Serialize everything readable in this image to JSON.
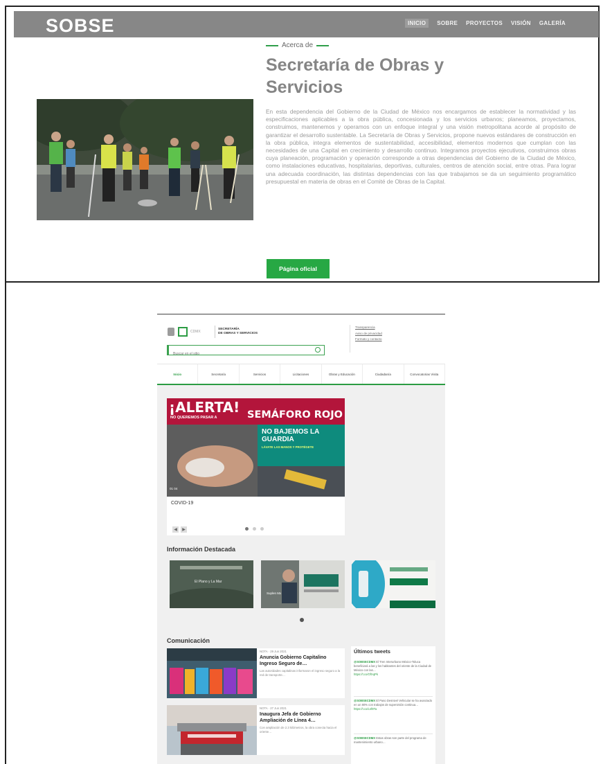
{
  "top_site": {
    "brand": "SOBSE",
    "nav": [
      "INICIO",
      "SOBRE",
      "PROYECTOS",
      "VISIÓN",
      "GALERÍA"
    ],
    "about_kicker": "Acerca de",
    "about_title": "Secretaría de Obras y Servicios",
    "about_body": "En esta dependencia del Gobierno de la Ciudad de México nos encargamos de establecer la normatividad y las especificaciones aplicables a la obra pública, concesionada y los servicios urbanos; planeamos, proyectamos, construimos, mantenemos y operamos con un enfoque integral y una visión metropolitana acorde al propósito de garantizar el desarrollo sustentable. La Secretaría de Obras y Servicios, propone nuevos estándares de construcción en la obra pública, integra elementos de sustentabilidad, accesibilidad, elementos modernos que cumplan con las necesidades de una Capital en crecimiento y desarrollo continuo. Integramos proyectos ejecutivos, construimos obras cuya planeación, programación y operación corresponde a otras dependencias del Gobierno de la Ciudad de México, como instalaciones educativas, hospitalarias, deportivas, culturales, centros de atención social, entre otras. Para lograr una adecuada coordinación, las distintas dependencias con las que trabajamos se da un seguimiento programático presupuestal en materia de obras en el Comité de Obras de la Capital.",
    "button_label": "Página oficial"
  },
  "gov_site": {
    "logo_small": "CDMX",
    "logo_name_1": "SECRETARÍA",
    "logo_name_2": "DE OBRAS Y SERVICIOS",
    "search_placeholder": "Buscar en el sitio",
    "header_links": [
      "Transparencia",
      "Aviso de privacidad",
      "Formato y contacto"
    ],
    "menu": [
      "Inicio",
      "Secretaría",
      "Servicios",
      "Licitaciones",
      "Obras y Educación",
      "Ciudadanía",
      "Convocatorias Visita"
    ],
    "banner_alerta": "¡ALERTA!",
    "banner_sub": "NO QUEREMOS PASAR A",
    "banner_semaforo": "SEMÁFORO ROJO",
    "guard_title": "NO BAJEMOS LA GUARDIA",
    "guard_sub": "LÁVATE LAS MANOS Y PROTÉGETE",
    "banner_tag": "01 04",
    "banner_caption": "COVID-19",
    "section_info": "Información Destacada",
    "card1_text": "El Plano y La Mar",
    "card2_text": "Suplen Mx",
    "section_com": "Comunicación",
    "news": [
      {
        "tag": "NOTA · 29 Jun 2021",
        "title": "Anuncia Gobierno Capitalino Ingreso Seguro de…",
        "summary": "Las autoridades capitalinas informaron el ingreso seguro a la red de transporte…"
      },
      {
        "tag": "NOTA · 27 Jun 2021",
        "title": "Inaugura Jefa de Gobierno Ampliación de Línea 4…",
        "summary": "Con ampliación de 2.3 kilómetros, la obra conecta hacia el oriente…"
      }
    ],
    "side_title": "Últimos tweets",
    "tweets": [
      {
        "handle": "@SOBSECDMX",
        "text": "El Tren Interurbano México-Toluca beneficiará a las y los habitantes del oriente de la Ciudad de México con las…",
        "link": "https://t.co/OfXqPk"
      },
      {
        "handle": "@SOBSECDMX",
        "text": "El Paso Desnivel Vehicular se ha avanzado en un 80% con trabajos de supervisión continua…",
        "link": "https://t.co/Lnf8Ta"
      },
      {
        "handle": "@SOBSECDMX",
        "text": "Estas obras son parte del programa de mantenimiento urbano…",
        "link": ""
      }
    ]
  }
}
